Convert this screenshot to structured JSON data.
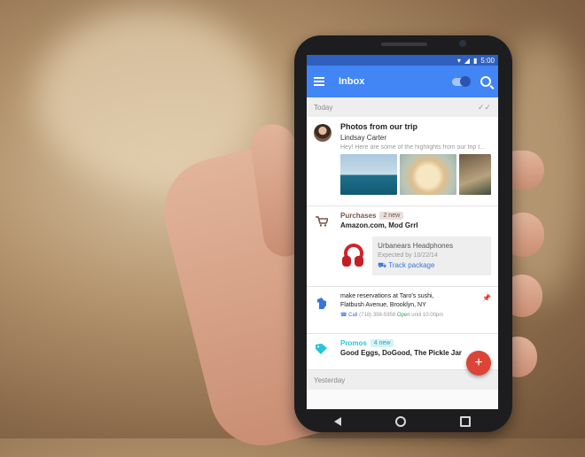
{
  "status": {
    "time": "5:00"
  },
  "appbar": {
    "title": "Inbox"
  },
  "sections": {
    "today": "Today",
    "yesterday": "Yesterday"
  },
  "photos_card": {
    "subject": "Photos from our trip",
    "sender": "Lindsay Carter",
    "snippet": "Hey! Here are some of the highlights from our trip t..."
  },
  "purchases_card": {
    "category": "Purchases",
    "badge": "2 new",
    "senders": "Amazon.com, Mod Grrl",
    "package": {
      "item": "Urbanears Headphones",
      "expected": "Expected by 10/22/14",
      "action": "Track package"
    }
  },
  "reminder_card": {
    "line1": "make reservations at Taro's sushi,",
    "line2": "Flatbush Avenue, Brooklyn, NY",
    "call": "Call",
    "phone": "(718) 398-5958",
    "open": "Open",
    "hours": "until 10:00pm"
  },
  "promos_card": {
    "category": "Promos",
    "badge": "4 new",
    "senders": "Good Eggs, DoGood, The Pickle Jar"
  },
  "fab": {
    "label": "+"
  },
  "colors": {
    "primary": "#4285f4",
    "purchases": "#795548",
    "promos": "#26c6da",
    "fab": "#db4437"
  }
}
